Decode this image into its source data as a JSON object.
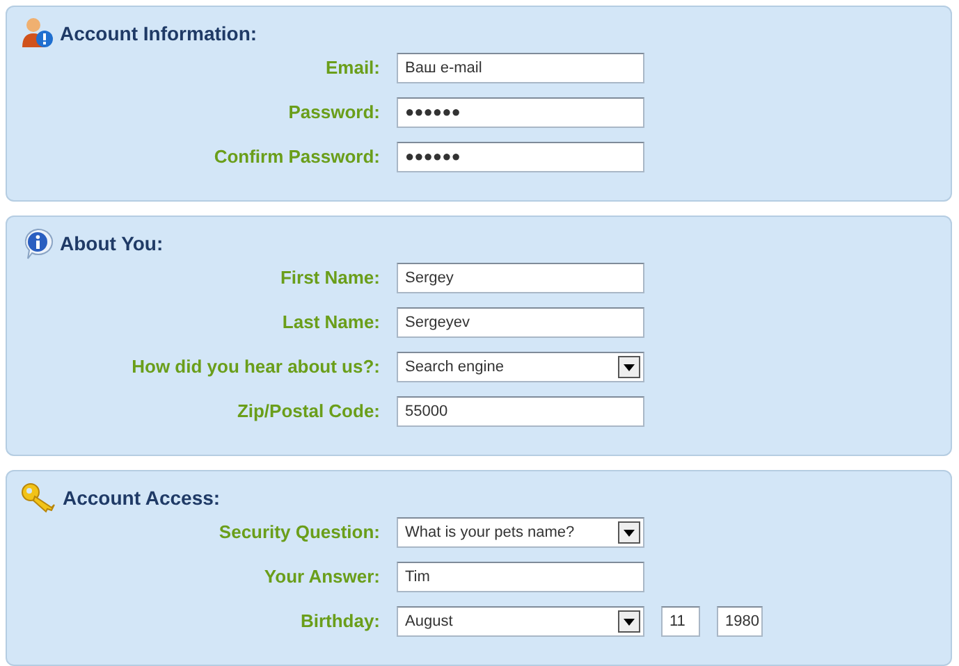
{
  "sections": [
    {
      "kind": "user",
      "title": "Account Information:",
      "fields": [
        {
          "kind": "text",
          "label": "Email:",
          "value": "Ваш e-mail"
        },
        {
          "kind": "text",
          "label": "Password:",
          "value": "●●●●●●"
        },
        {
          "kind": "text",
          "label": "Confirm Password:",
          "value": "●●●●●●"
        }
      ]
    },
    {
      "kind": "info",
      "title": "About You:",
      "fields": [
        {
          "kind": "text",
          "label": "First Name:",
          "value": "Sergey"
        },
        {
          "kind": "text",
          "label": "Last Name:",
          "value": "Sergeyev"
        },
        {
          "kind": "select",
          "label": "How did you hear about us?:",
          "value": "Search engine"
        },
        {
          "kind": "text",
          "label": "Zip/Postal Code:",
          "value": "55000"
        }
      ]
    },
    {
      "kind": "key",
      "title": "Account Access:",
      "fields": [
        {
          "kind": "select",
          "label": "Security Question:",
          "value": "What is your pets name?"
        },
        {
          "kind": "text",
          "label": "Your Answer:",
          "value": "Tim"
        },
        {
          "kind": "date",
          "label": "Birthday:",
          "month": "August",
          "day": "11",
          "year": "1980"
        }
      ]
    }
  ]
}
